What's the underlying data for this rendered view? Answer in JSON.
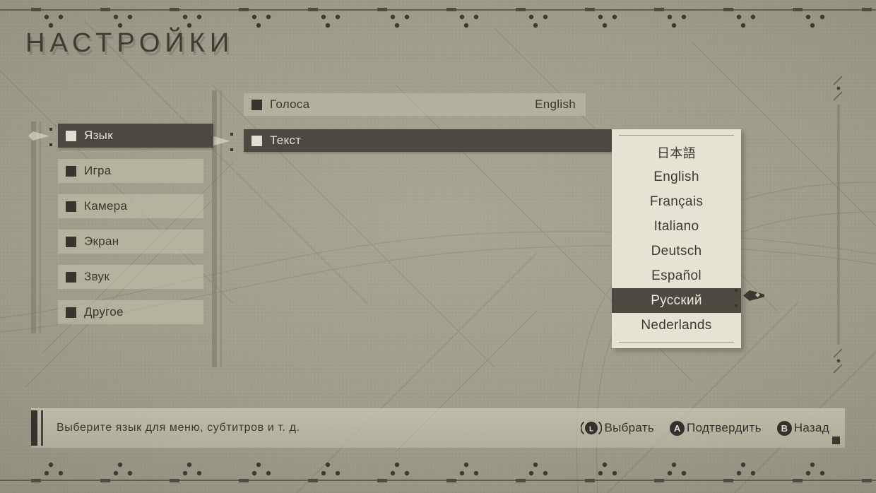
{
  "page": {
    "title": "НАСТРОЙКИ",
    "background_color": "#9b9a88",
    "accent_dark": "#4c4a40",
    "panel_light": "#e5e3d4",
    "text_dark": "#3b392f",
    "text_light": "#e4e2d4"
  },
  "sidebar": {
    "items": [
      {
        "label": "Язык",
        "selected": true
      },
      {
        "label": "Игра",
        "selected": false
      },
      {
        "label": "Камера",
        "selected": false
      },
      {
        "label": "Экран",
        "selected": false
      },
      {
        "label": "Звук",
        "selected": false
      },
      {
        "label": "Другое",
        "selected": false
      }
    ]
  },
  "settings_panel": {
    "rows": [
      {
        "label": "Голоса",
        "value": "English",
        "selected": false
      },
      {
        "label": "Текст",
        "value": "",
        "selected": true
      }
    ]
  },
  "dropdown": {
    "open": true,
    "options": [
      {
        "label": "日本語",
        "selected": false
      },
      {
        "label": "English",
        "selected": false
      },
      {
        "label": "Français",
        "selected": false
      },
      {
        "label": "Italiano",
        "selected": false
      },
      {
        "label": "Deutsch",
        "selected": false
      },
      {
        "label": "Español",
        "selected": false
      },
      {
        "label": "Русский",
        "selected": true
      },
      {
        "label": "Nederlands",
        "selected": false
      }
    ]
  },
  "help_bar": {
    "description": "Выберите язык для меню, субтитров и т. д.",
    "prompts": [
      {
        "icon": "left-stick-icon",
        "glyph": "L",
        "label": "Выбрать"
      },
      {
        "icon": "a-button-icon",
        "glyph": "A",
        "label": "Подтвердить"
      },
      {
        "icon": "b-button-icon",
        "glyph": "B",
        "label": "Назад"
      }
    ]
  }
}
